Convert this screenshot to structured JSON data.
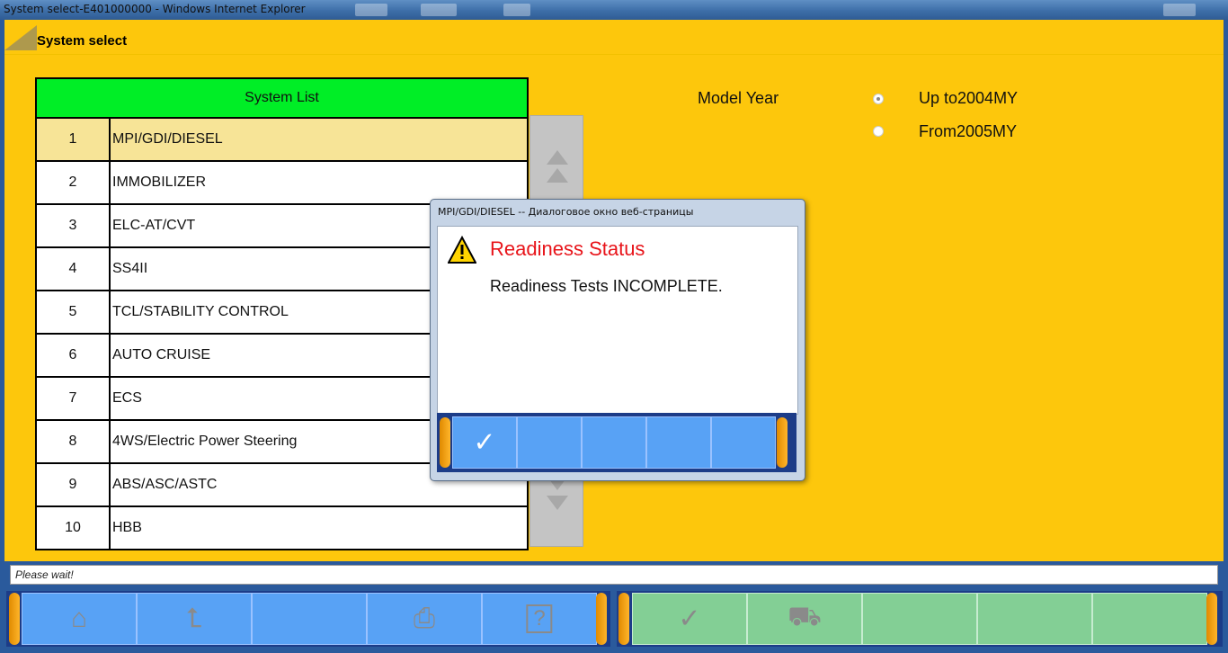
{
  "window": {
    "title": "System select-E401000000 - Windows Internet Explorer"
  },
  "header": {
    "title": "System select"
  },
  "system_list": {
    "heading": "System List",
    "rows": [
      {
        "num": "1",
        "name": "MPI/GDI/DIESEL"
      },
      {
        "num": "2",
        "name": "IMMOBILIZER"
      },
      {
        "num": "3",
        "name": "ELC-AT/CVT"
      },
      {
        "num": "4",
        "name": "SS4II"
      },
      {
        "num": "5",
        "name": "TCL/STABILITY CONTROL"
      },
      {
        "num": "6",
        "name": "AUTO CRUISE"
      },
      {
        "num": "7",
        "name": "ECS"
      },
      {
        "num": "8",
        "name": "4WS/Electric Power Steering"
      },
      {
        "num": "9",
        "name": "ABS/ASC/ASTC"
      },
      {
        "num": "10",
        "name": "HBB"
      }
    ]
  },
  "model_year": {
    "label": "Model Year",
    "options": [
      "Up to2004MY",
      "From2005MY"
    ],
    "selected": "Up to2004MY"
  },
  "status": {
    "text": "Please wait!"
  },
  "dialog": {
    "title": "MPI/GDI/DIESEL -- Диалоговое окно веб-страницы",
    "heading": "Readiness Status",
    "message": "Readiness Tests INCOMPLETE."
  },
  "colors": {
    "background": "#fdc70c",
    "list_header": "#00ee26",
    "selected_row": "#f7e497",
    "toolbar": "#1c3c88"
  }
}
